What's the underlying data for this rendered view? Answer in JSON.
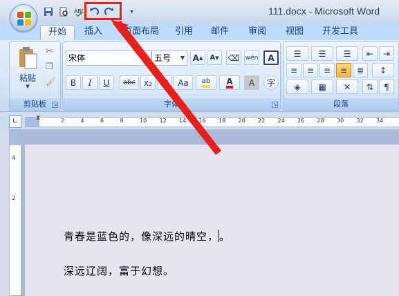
{
  "window": {
    "title": "111.docx - Microsoft Word"
  },
  "quick_access": {
    "save": "save-icon",
    "print_preview": "print-preview-icon",
    "spelling": "spelling-icon",
    "undo": "undo-icon",
    "redo": "redo-icon",
    "customize": "▾"
  },
  "tabs": [
    "开始",
    "插入",
    "页面布局",
    "引用",
    "邮件",
    "审阅",
    "视图",
    "开发工具"
  ],
  "clipboard": {
    "paste_label": "粘贴",
    "group_label": "剪贴板"
  },
  "font": {
    "name": "宋体",
    "size": "五号",
    "group_label": "字体",
    "buttons": {
      "bold": "B",
      "italic": "I",
      "underline": "U",
      "strike": "abc",
      "subscript": "x₂",
      "superscript": "x²",
      "change_case": "Aa",
      "font_color": "A",
      "shade": "A",
      "enclose": "字"
    }
  },
  "paragraph": {
    "group_label": "段落"
  },
  "ruler": {
    "ticks": [
      "2",
      "4",
      "6",
      "8",
      "10",
      "12",
      "14",
      "16",
      "18",
      "20",
      "22",
      "24",
      "26",
      "28",
      "30",
      "32",
      "34"
    ],
    "vticks": [
      "4",
      "2"
    ]
  },
  "document": {
    "line1": "青春是蓝色的，像深远的晴空，",
    "line1_end": "。",
    "line2": "深远辽阔，富于幻想。"
  },
  "colors": {
    "annotation": "#e8201c",
    "highlight": "#ffd93b",
    "font_color": "#e01010"
  }
}
